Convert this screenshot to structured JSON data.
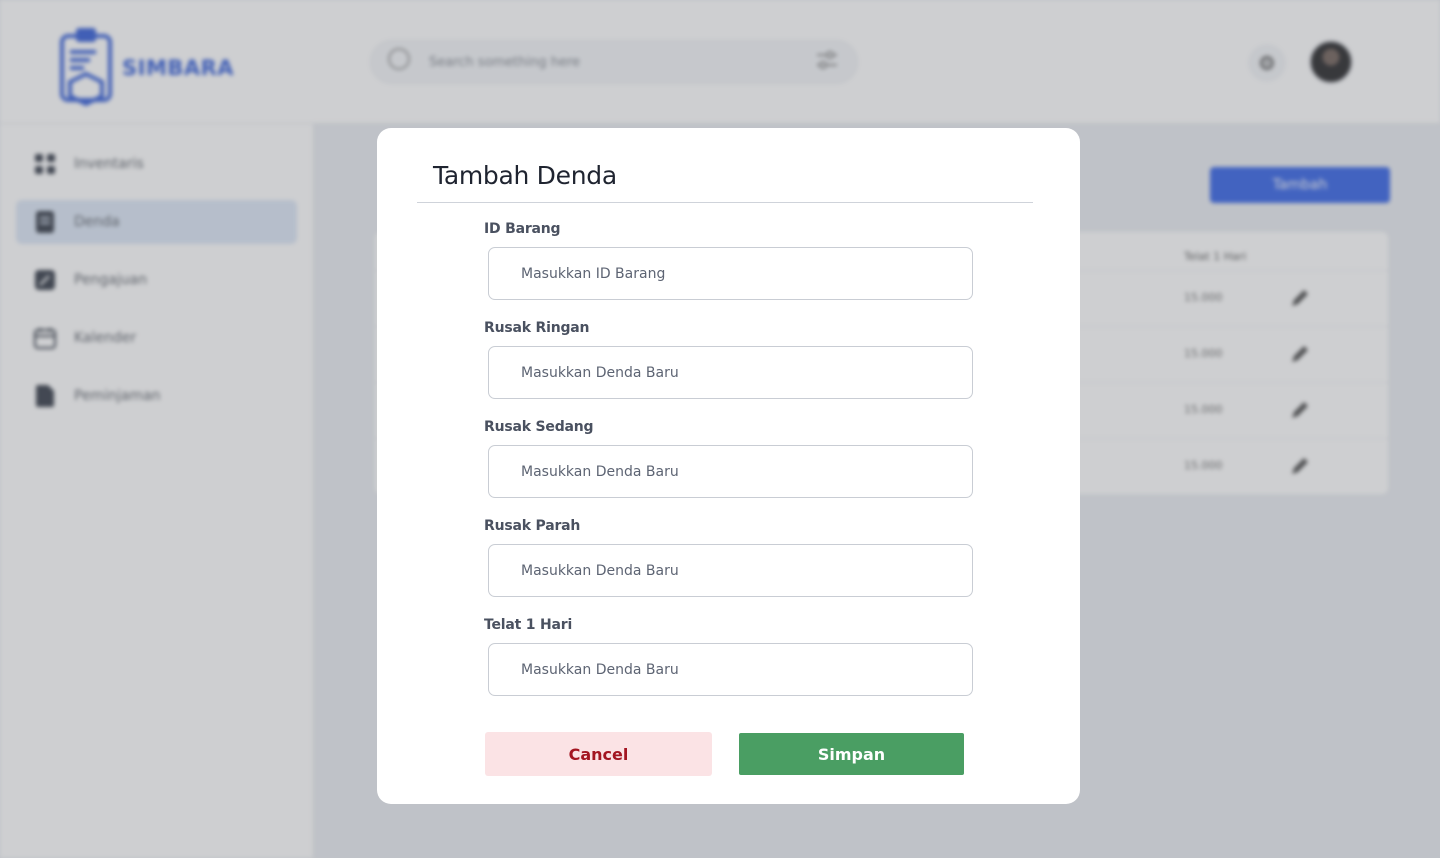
{
  "app": {
    "name": "SIMBARA"
  },
  "search": {
    "placeholder": "Search something here"
  },
  "sidebar": {
    "items": [
      {
        "label": "Inventaris",
        "icon": "grid-icon"
      },
      {
        "label": "Denda",
        "icon": "document-icon",
        "active": true
      },
      {
        "label": "Pengajuan",
        "icon": "edit-icon"
      },
      {
        "label": "Kalender",
        "icon": "calendar-icon"
      },
      {
        "label": "Peminjaman",
        "icon": "file-icon"
      }
    ]
  },
  "content": {
    "add_button": "Tambah",
    "table": {
      "visible_header": "Telat 1 Hari",
      "rows": [
        {
          "telat": "15.000"
        },
        {
          "telat": "15.000"
        },
        {
          "telat": "15.000"
        },
        {
          "telat": "15.000"
        }
      ]
    }
  },
  "modal": {
    "title": "Tambah Denda",
    "fields": [
      {
        "label": "ID Barang",
        "placeholder": "Masukkan ID Barang"
      },
      {
        "label": "Rusak Ringan",
        "placeholder": "Masukkan Denda Baru"
      },
      {
        "label": "Rusak Sedang",
        "placeholder": "Masukkan Denda Baru"
      },
      {
        "label": "Rusak Parah",
        "placeholder": "Masukkan Denda Baru"
      },
      {
        "label": "Telat 1 Hari",
        "placeholder": "Masukkan Denda Baru"
      }
    ],
    "cancel_label": "Cancel",
    "save_label": "Simpan"
  },
  "colors": {
    "brand": "#2a56d6",
    "primary_button": "#2b5ce6",
    "save": "#4a9e63",
    "cancel_bg": "#fbe3e5",
    "cancel_text": "#a31521"
  }
}
